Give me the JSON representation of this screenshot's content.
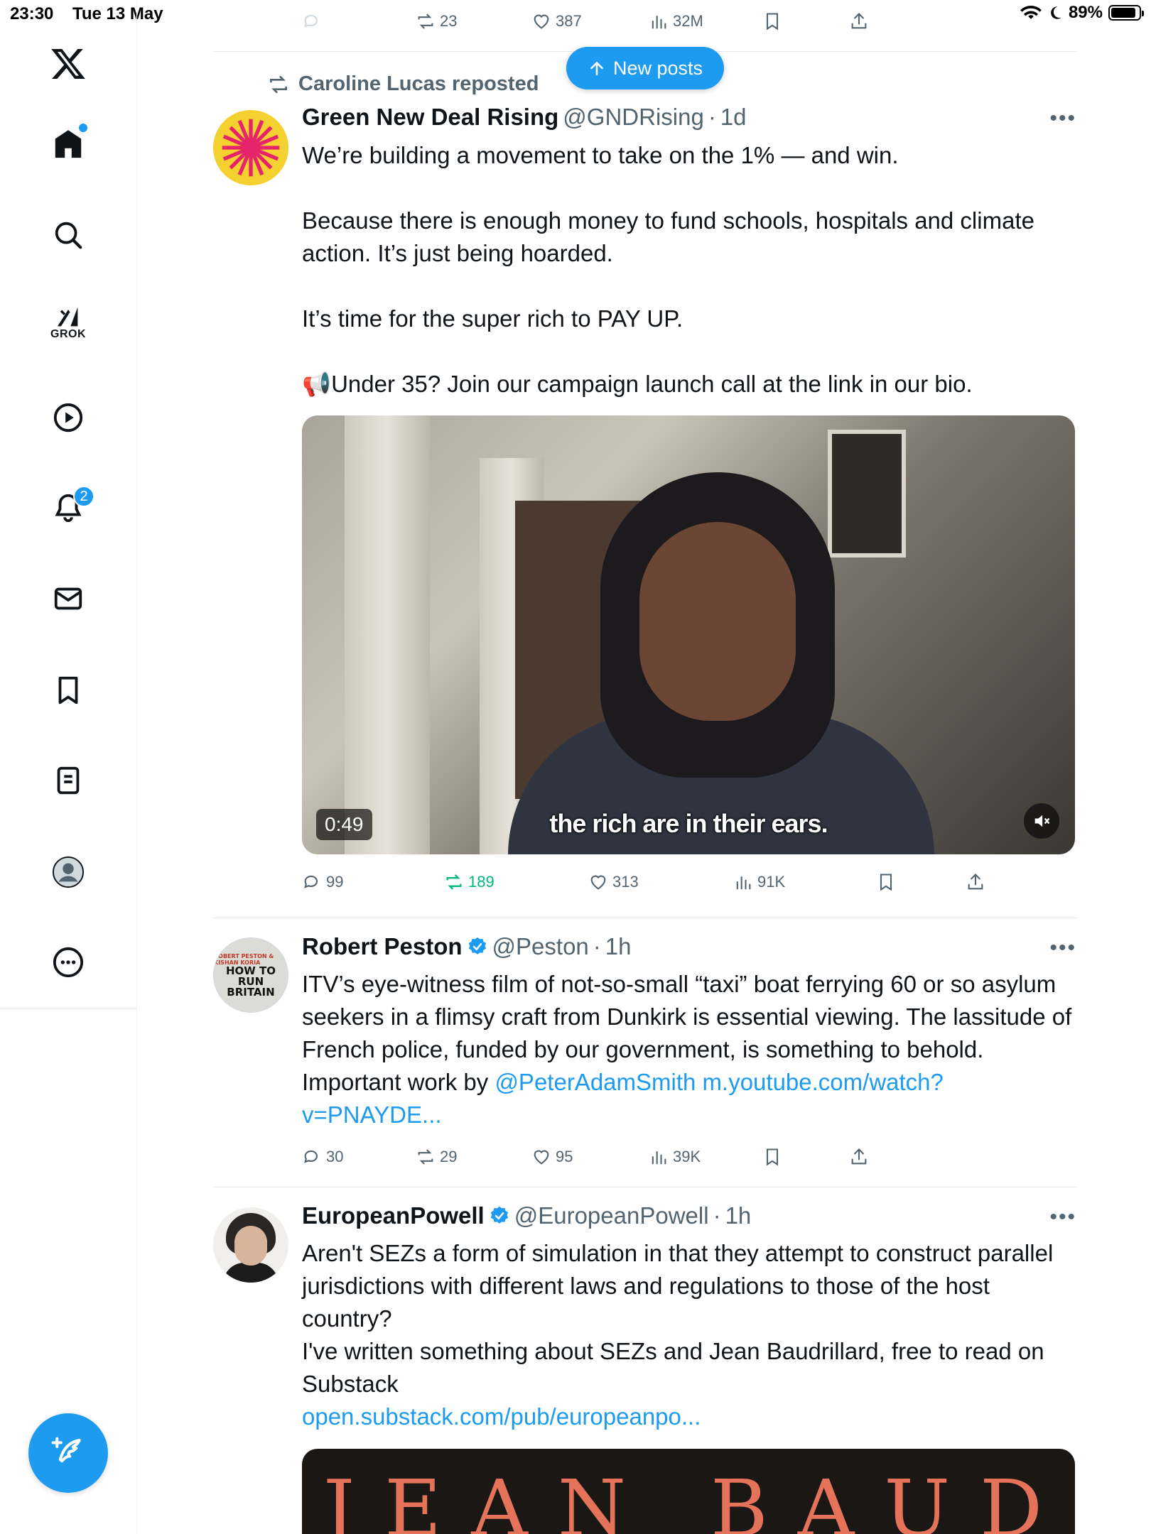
{
  "status_bar": {
    "time": "23:30",
    "date": "Tue 13 May",
    "battery": "89%",
    "battery_level": 0.89
  },
  "sidebar": {
    "notifications_badge": "2",
    "grok_label": "GROK"
  },
  "new_posts_label": "New posts",
  "top_actions": {
    "reposts": "23",
    "likes": "387",
    "views": "32M"
  },
  "tweets": [
    {
      "repost_by": "Caroline Lucas reposted",
      "name": "Green New Deal Rising",
      "handle": "@GNDRising",
      "sep": "·",
      "time": "1d",
      "text": [
        "We’re building a movement to take on the 1% — and win.",
        "Because there is enough money to fund schools, hospitals and climate action. It’s just being hoarded.",
        "It’s time for the super rich to PAY UP.",
        "📢Under 35? Join our campaign launch call at the link in our bio."
      ],
      "video_duration": "0:49",
      "video_caption": "the rich are in their ears.",
      "replies": "99",
      "reposts": "189",
      "likes": "313",
      "views": "91K"
    },
    {
      "name": "Robert Peston",
      "handle": "@Peston",
      "sep": "·",
      "time": "1h",
      "text_plain": "ITV’s eye-witness film of not-so-small “taxi” boat ferrying 60 or so asylum seekers in a flimsy craft from Dunkirk is essential viewing.  The lassitude of French police, funded by our government, is something to behold. Important work by ",
      "mention": "@PeterAdamSmith",
      "link": "m.youtube.com/watch?v=PNAYDE...",
      "avatar_small": "ROBERT PESTON & KISHAN KORIA",
      "avatar_big": [
        "HOW TO",
        "RUN",
        "BRITAIN"
      ],
      "replies": "30",
      "reposts": "29",
      "likes": "95",
      "views": "39K"
    },
    {
      "name": "EuropeanPowell",
      "handle": "@EuropeanPowell",
      "sep": "·",
      "time": "1h",
      "text": [
        "Aren't SEZs a form of simulation in that they attempt to construct parallel jurisdictions with different laws and regulations to those of the host country?",
        "I've written something about SEZs and Jean Baudrillard, free to read on Substack"
      ],
      "link": "open.substack.com/pub/europeanpo...",
      "image_text": "JEAN BAUDRILLARD"
    }
  ],
  "colors": {
    "accent": "#1d9bf0",
    "text": "#0f1419",
    "muted": "#536471",
    "repost_green": "#00ba7c"
  }
}
